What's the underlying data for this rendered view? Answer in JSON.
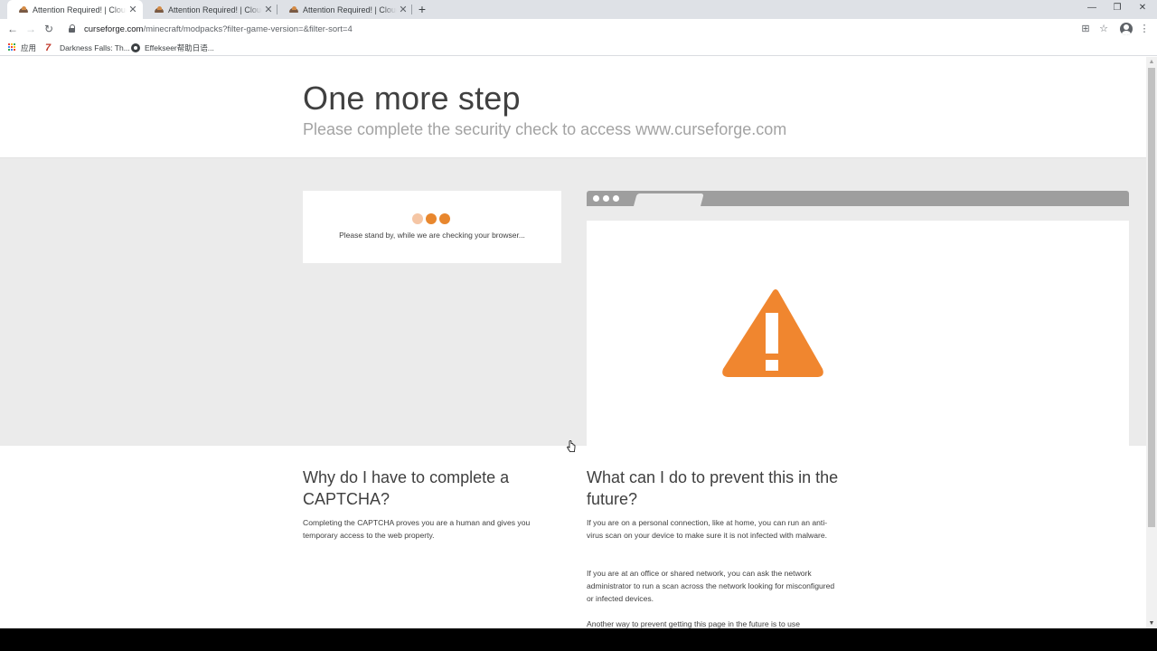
{
  "browser": {
    "tabs": [
      {
        "title": "Attention Required! | Cloudflare",
        "active": true
      },
      {
        "title": "Attention Required! | Cloudflare",
        "active": false
      },
      {
        "title": "Attention Required! | Cloudflare",
        "active": false
      }
    ],
    "new_tab_icon": "plus-icon",
    "url_host": "curseforge.com",
    "url_rest": "/minecraft/modpacks?filter-game-version=&filter-sort=4",
    "bookmarks": [
      {
        "label": "应用",
        "icon": "apps-grid-icon"
      },
      {
        "label": "Darkness Falls: Th...",
        "icon": "darkness-falls-icon"
      },
      {
        "label": "Effekseer帮助日语...",
        "icon": "globe-icon"
      }
    ]
  },
  "page": {
    "title": "One more step",
    "subtitle": "Please complete the security check to access www.curseforge.com",
    "check_message": "Please stand by, while we are checking your browser...",
    "why_title": "Why do I have to complete a CAPTCHA?",
    "why_text": "Completing the CAPTCHA proves you are a human and gives you temporary access to the web property.",
    "prevent_title": "What can I do to prevent this in the future?",
    "prevent_paragraphs": [
      "If you are on a personal connection, like at home, you can run an anti-virus scan on your device to make sure it is not infected with malware.",
      "If you are at an office or shared network, you can ask the network administrator to run a scan across the network looking for misconfigured or infected devices.",
      "Another way to prevent getting this page in the future is to use"
    ]
  },
  "colors": {
    "accent_orange": "#f0862f",
    "loading_dot_light": "#f5c6a5",
    "loading_dot_dark": "#e8872e",
    "band_gray": "#ebebeb",
    "frame_gray": "#9e9e9e"
  }
}
